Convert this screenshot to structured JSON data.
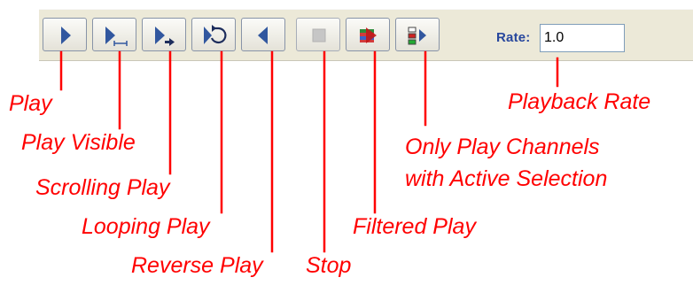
{
  "toolbar": {
    "buttons": [
      {
        "id": "play",
        "icon": "play-icon",
        "enabled": true
      },
      {
        "id": "play-visible",
        "icon": "play-visible-icon",
        "enabled": true
      },
      {
        "id": "scrolling-play",
        "icon": "scrolling-play-icon",
        "enabled": true
      },
      {
        "id": "looping-play",
        "icon": "looping-play-icon",
        "enabled": true
      },
      {
        "id": "reverse-play",
        "icon": "reverse-play-icon",
        "enabled": true
      },
      {
        "id": "stop",
        "icon": "stop-icon",
        "enabled": false
      },
      {
        "id": "filtered-play",
        "icon": "filtered-play-icon",
        "enabled": true
      },
      {
        "id": "active-selection-play",
        "icon": "active-channels-play-icon",
        "enabled": true
      }
    ],
    "rate_label": "Rate:",
    "rate_value": "1.0"
  },
  "callouts": {
    "play": "Play",
    "play_visible": "Play Visible",
    "scrolling_play": "Scrolling Play",
    "looping_play": "Looping Play",
    "reverse_play": "Reverse Play",
    "stop": "Stop",
    "filtered_play": "Filtered Play",
    "active_selection_line1": "Only Play Channels",
    "active_selection_line2": "with Active Selection",
    "playback_rate": "Playback Rate"
  },
  "colors": {
    "callout": "#ff0000",
    "icon_blue": "#31579f",
    "label_blue": "#27479d",
    "toolbar_bg": "#ece9d8"
  }
}
